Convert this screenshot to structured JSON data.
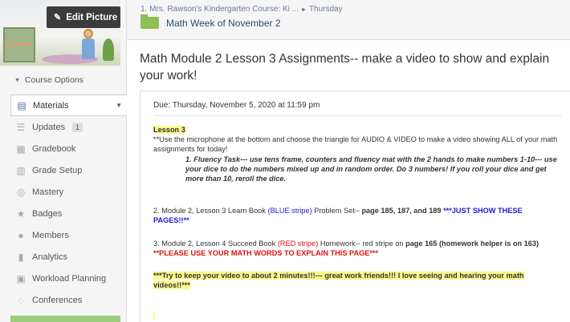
{
  "sidebar": {
    "edit_picture_label": "Edit Picture",
    "course_options_label": "Course Options",
    "nav": [
      {
        "label": "Materials",
        "icon": "materials-icon",
        "active": true
      },
      {
        "label": "Updates",
        "icon": "updates-icon",
        "badge": "1"
      },
      {
        "label": "Gradebook",
        "icon": "gradebook-icon"
      },
      {
        "label": "Grade Setup",
        "icon": "grade-setup-icon"
      },
      {
        "label": "Mastery",
        "icon": "mastery-icon"
      },
      {
        "label": "Badges",
        "icon": "badges-icon"
      },
      {
        "label": "Members",
        "icon": "members-icon"
      },
      {
        "label": "Analytics",
        "icon": "analytics-icon"
      },
      {
        "label": "Workload Planning",
        "icon": "workload-planning-icon"
      },
      {
        "label": "Conferences",
        "icon": "conferences-icon"
      }
    ]
  },
  "header": {
    "breadcrumb_course": "1. Mrs. Rawson's Kindergarten Course: Ki ...",
    "breadcrumb_folder": "Thursday",
    "folder_title": "Math Week of November 2"
  },
  "page_title": "Math Module 2 Lesson 3 Assignments-- make a video to show and explain your work!",
  "assignment": {
    "due": "Due: Thursday, November 5, 2020 at 11:59 pm",
    "lesson_heading": "Lesson 3",
    "intro": "**Use the microphone at the bottom and choose the triangle for AUDIO & VIDEO to make a video showing ALL of your math assignments for today!",
    "task1": "1.   Fluency Task--- use tens frame, counters and fluency mat with the 2 hands to make numbers 1-10--- use your dice to do the numbers mixed up and in random order.  Do 3 numbers! If you roll your dice and get more than 10, reroll the dice.",
    "task2_a": "2.  Module 2, Lesson 3 Learn Book ",
    "task2_b": "(BLUE stripe)",
    "task2_c": " Problem Set-- ",
    "task2_d": "page 185, 187, and 189",
    "task2_e": "  ***JUST SHOW THESE PAGES!!**",
    "task3_a": "3. Module 2, Lesson 4 Succeed Book ",
    "task3_b": "(RED stripe)",
    "task3_c": " Homework-- red stripe on ",
    "task3_d": "page 165 (homework helper is on 163)",
    "task3_e": " **PLEASE USE YOUR MATH WORDS TO EXPLAIN THIS PAGE***",
    "closing": "***Try to keep your video to about 2 minutes!!!--- great work friends!!!  I love seeing and hearing your math videos!!***"
  },
  "colors": {
    "accent_green": "#8cbf55",
    "highlight_yellow": "#fbf78a",
    "link_blue": "#1b1bcf",
    "alert_red": "#dd1111"
  }
}
